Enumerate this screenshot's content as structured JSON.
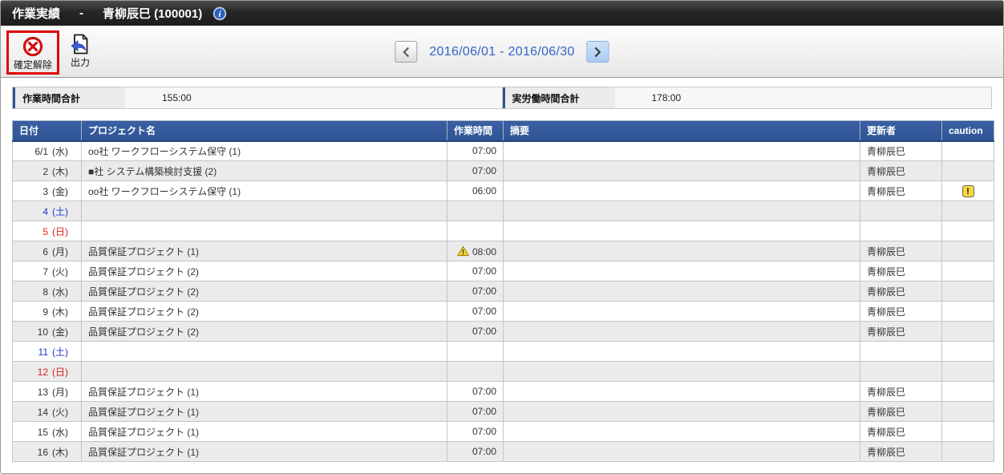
{
  "window": {
    "title": "作業実績",
    "separator": "-",
    "user": "青柳辰巳 (100001)"
  },
  "toolbar": {
    "unconfirm_label": "確定解除",
    "export_label": "出力"
  },
  "date_nav": {
    "range_label": "2016/06/01 - 2016/06/30"
  },
  "summary": {
    "work_total_label": "作業時間合計",
    "work_total_value": "155:00",
    "actual_total_label": "実労働時間合計",
    "actual_total_value": "178:00"
  },
  "table": {
    "columns": [
      "日付",
      "プロジェクト名",
      "作業時間",
      "摘要",
      "更新者",
      "caution"
    ],
    "rows": [
      {
        "date": "6/1",
        "weekday": "(水)",
        "day_type": "weekday",
        "project": "oo社 ワークフローシステム保守 (1)",
        "time": "07:00",
        "time_warning": false,
        "note": "",
        "updater": "青柳辰巳",
        "caution": false
      },
      {
        "date": "2",
        "weekday": "(木)",
        "day_type": "weekday",
        "project": "■社 システム構築検討支援 (2)",
        "time": "07:00",
        "time_warning": false,
        "note": "",
        "updater": "青柳辰巳",
        "caution": false
      },
      {
        "date": "3",
        "weekday": "(金)",
        "day_type": "weekday",
        "project": "oo社 ワークフローシステム保守 (1)",
        "time": "06:00",
        "time_warning": false,
        "note": "",
        "updater": "青柳辰巳",
        "caution": true
      },
      {
        "date": "4",
        "weekday": "(土)",
        "day_type": "saturday",
        "project": "",
        "time": "",
        "time_warning": false,
        "note": "",
        "updater": "",
        "caution": false
      },
      {
        "date": "5",
        "weekday": "(日)",
        "day_type": "sunday",
        "project": "",
        "time": "",
        "time_warning": false,
        "note": "",
        "updater": "",
        "caution": false
      },
      {
        "date": "6",
        "weekday": "(月)",
        "day_type": "weekday",
        "project": "品質保証プロジェクト (1)",
        "time": "08:00",
        "time_warning": true,
        "note": "",
        "updater": "青柳辰巳",
        "caution": false
      },
      {
        "date": "7",
        "weekday": "(火)",
        "day_type": "weekday",
        "project": "品質保証プロジェクト (2)",
        "time": "07:00",
        "time_warning": false,
        "note": "",
        "updater": "青柳辰巳",
        "caution": false
      },
      {
        "date": "8",
        "weekday": "(水)",
        "day_type": "weekday",
        "project": "品質保証プロジェクト (2)",
        "time": "07:00",
        "time_warning": false,
        "note": "",
        "updater": "青柳辰巳",
        "caution": false
      },
      {
        "date": "9",
        "weekday": "(木)",
        "day_type": "weekday",
        "project": "品質保証プロジェクト (2)",
        "time": "07:00",
        "time_warning": false,
        "note": "",
        "updater": "青柳辰巳",
        "caution": false
      },
      {
        "date": "10",
        "weekday": "(金)",
        "day_type": "weekday",
        "project": "品質保証プロジェクト (2)",
        "time": "07:00",
        "time_warning": false,
        "note": "",
        "updater": "青柳辰巳",
        "caution": false
      },
      {
        "date": "11",
        "weekday": "(土)",
        "day_type": "saturday",
        "project": "",
        "time": "",
        "time_warning": false,
        "note": "",
        "updater": "",
        "caution": false
      },
      {
        "date": "12",
        "weekday": "(日)",
        "day_type": "sunday",
        "project": "",
        "time": "",
        "time_warning": false,
        "note": "",
        "updater": "",
        "caution": false
      },
      {
        "date": "13",
        "weekday": "(月)",
        "day_type": "weekday",
        "project": "品質保証プロジェクト (1)",
        "time": "07:00",
        "time_warning": false,
        "note": "",
        "updater": "青柳辰巳",
        "caution": false
      },
      {
        "date": "14",
        "weekday": "(火)",
        "day_type": "weekday",
        "project": "品質保証プロジェクト (1)",
        "time": "07:00",
        "time_warning": false,
        "note": "",
        "updater": "青柳辰巳",
        "caution": false
      },
      {
        "date": "15",
        "weekday": "(水)",
        "day_type": "weekday",
        "project": "品質保証プロジェクト (1)",
        "time": "07:00",
        "time_warning": false,
        "note": "",
        "updater": "青柳辰巳",
        "caution": false
      },
      {
        "date": "16",
        "weekday": "(木)",
        "day_type": "weekday",
        "project": "品質保証プロジェクト (1)",
        "time": "07:00",
        "time_warning": false,
        "note": "",
        "updater": "青柳辰巳",
        "caution": false
      }
    ]
  },
  "colors": {
    "header_blue": "#2f5496",
    "saturday_blue": "#2233cc",
    "sunday_red": "#e01919",
    "caution_yellow": "#f8d73e",
    "warning_yellow": "#ffd21e",
    "highlight_red": "#e00505",
    "date_nav_blue": "#3464c8"
  }
}
